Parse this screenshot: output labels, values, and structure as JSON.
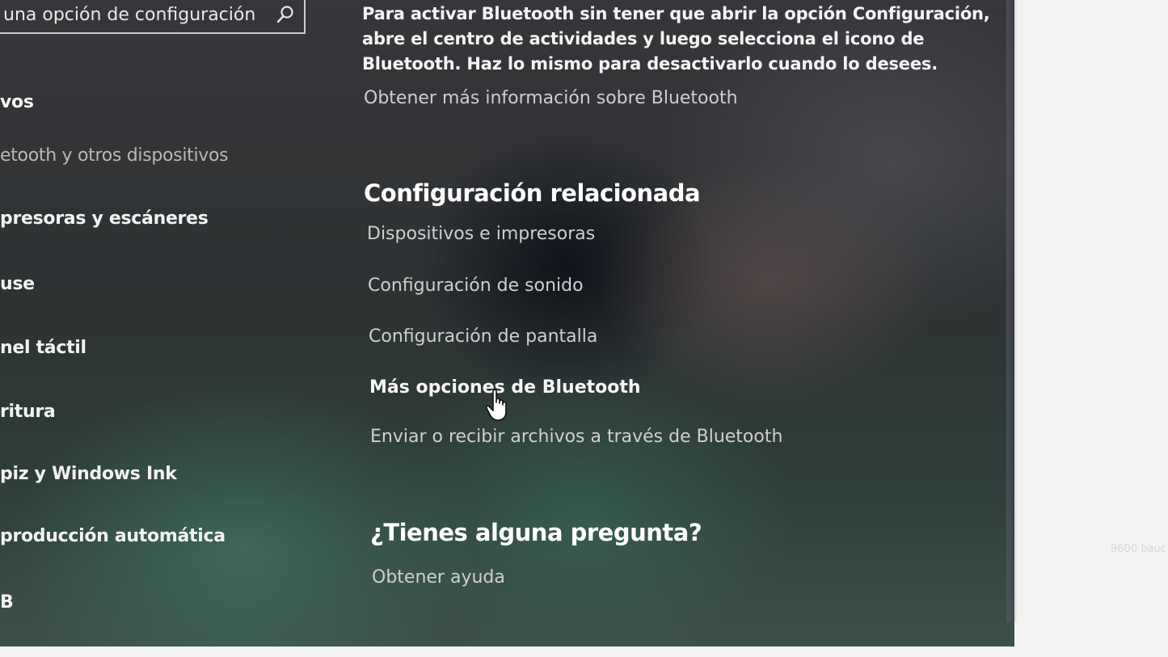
{
  "sidebar": {
    "search_text": "una opción de configuración",
    "items": [
      {
        "label": "vos"
      },
      {
        "label": "etooth y otros dispositivos"
      },
      {
        "label": "presoras y escáneres"
      },
      {
        "label": "use"
      },
      {
        "label": "nel táctil"
      },
      {
        "label": "ritura"
      },
      {
        "label": "piz y Windows Ink"
      },
      {
        "label": "producción automática"
      },
      {
        "label": "B"
      }
    ]
  },
  "content": {
    "paragraph": "Para activar Bluetooth sin tener que abrir la opción Configuración, abre el centro de actividades y luego selecciona el icono de Bluetooth. Haz lo mismo para desactivarlo cuando lo desees.",
    "more_info_link": "Obtener más información sobre Bluetooth",
    "related_heading": "Configuración relacionada",
    "related_links": [
      "Dispositivos e impresoras",
      "Configuración de sonido",
      "Configuración de pantalla",
      "Más opciones de Bluetooth",
      "Enviar o recibir archivos a través de Bluetooth"
    ],
    "question_heading": "¿Tienes alguna pregunta?",
    "help_link": "Obtener ayuda"
  },
  "background": {
    "baud_text": "9600 bauc"
  },
  "colors": {
    "text_primary": "#f4f4f4",
    "text_secondary": "#cfcfcf"
  }
}
